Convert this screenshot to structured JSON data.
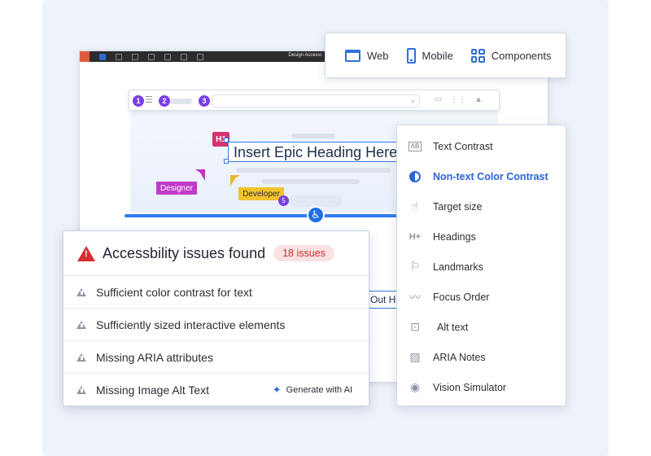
{
  "editor": {
    "title": "Design Accessi"
  },
  "browser": {
    "steps": [
      "1",
      "2",
      "3"
    ],
    "search_icon": "search-icon",
    "icons": [
      "video-icon",
      "grid-icon",
      "bell-icon"
    ]
  },
  "canvas": {
    "h1_tag": "H1",
    "heading": "Insert Epic Heading Here",
    "designer_label": "Designer",
    "developer_label": "Developer",
    "badge": "5",
    "partial_heading": "Out He"
  },
  "platform": {
    "items": [
      {
        "label": "Web",
        "icon": "browser-window-icon"
      },
      {
        "label": "Mobile",
        "icon": "mobile-phone-icon"
      },
      {
        "label": "Components",
        "icon": "components-grid-icon"
      }
    ]
  },
  "checks": {
    "items": [
      {
        "label": "Text Contrast",
        "icon": "text-contrast-icon"
      },
      {
        "label": "Non-text Color Contrast",
        "icon": "color-contrast-icon",
        "active": true
      },
      {
        "label": "Target size",
        "icon": "pointer-hand-icon"
      },
      {
        "label": "Headings",
        "icon": "heading-icon"
      },
      {
        "label": "Landmarks",
        "icon": "flag-icon"
      },
      {
        "label": "Focus Order",
        "icon": "focus-order-icon"
      },
      {
        "label": "Alt text",
        "icon": "image-alt-icon"
      },
      {
        "label": "ARIA Notes",
        "icon": "aria-notes-icon"
      },
      {
        "label": "Vision Simulator",
        "icon": "eye-icon"
      }
    ]
  },
  "issues": {
    "title": "Accessbility issues found",
    "count": "18 issues",
    "rows": [
      {
        "label": "Sufficient color contrast for text"
      },
      {
        "label": "Sufficiently sized interactive elements"
      },
      {
        "label": "Missing ARIA attributes"
      },
      {
        "label": "Missing Image Alt Text",
        "action": "Generate with AI"
      }
    ]
  },
  "colors": {
    "accent": "#2f6fd8",
    "warning": "#d22f2f",
    "designer": "#c13ac9",
    "developer": "#f2c32b",
    "badge": "#7b3fe4"
  }
}
